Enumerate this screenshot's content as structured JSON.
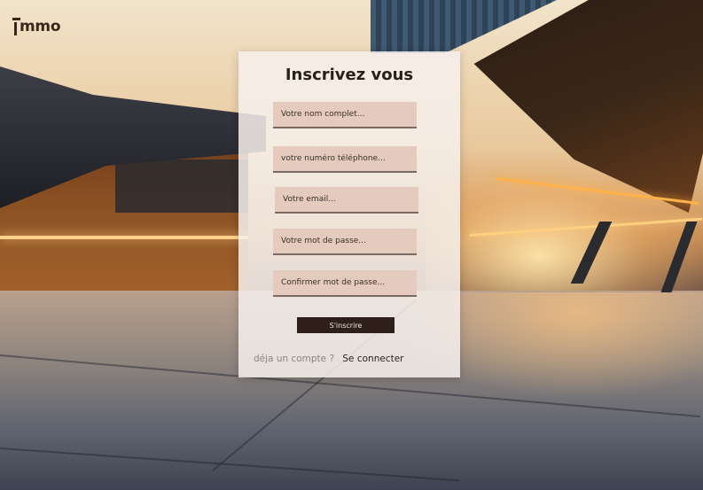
{
  "brand": {
    "logo_text": "mmo",
    "logo_full": "Immo",
    "brand_color": "#3a261a"
  },
  "form": {
    "title": "Inscrivez vous",
    "fields": [
      {
        "name": "full-name",
        "placeholder": "Votre nom complet...",
        "value": ""
      },
      {
        "name": "phone",
        "placeholder": "votre numéro téléphone...",
        "value": ""
      },
      {
        "name": "email",
        "placeholder": "Votre email...",
        "value": ""
      },
      {
        "name": "password",
        "placeholder": "Votre mot de passe...",
        "value": ""
      },
      {
        "name": "confirm-password",
        "placeholder": "Confirmer mot de passe...",
        "value": ""
      }
    ],
    "submit_label": "S'inscrire",
    "have_account_text": "déja un compte ?",
    "login_link_label": "Se connecter"
  },
  "colors": {
    "field_background": "#e4cbbd",
    "button_background": "#2e1f1a",
    "card_background": "#f6f0ec"
  }
}
